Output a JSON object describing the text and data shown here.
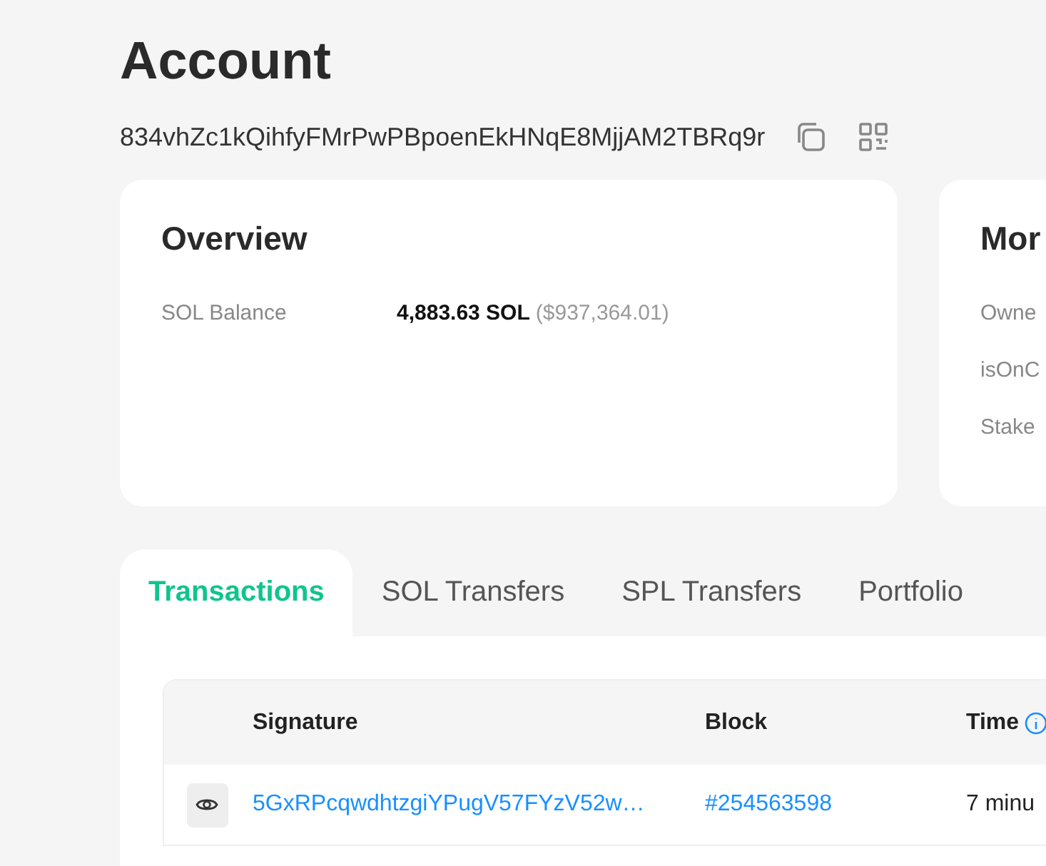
{
  "title": "Account",
  "address": "834vhZc1kQihfyFMrPwPBpoenEkHNqE8MjjAM2TBRq9r",
  "overview": {
    "title": "Overview",
    "rows": [
      {
        "label": "SOL Balance",
        "value": "4,883.63 SOL",
        "secondary": "($937,364.01)"
      }
    ]
  },
  "more_card": {
    "title": "Mor",
    "labels": [
      "Owne",
      "isOnC",
      "Stake"
    ]
  },
  "tabs": [
    {
      "label": "Transactions",
      "selected": true
    },
    {
      "label": "SOL Transfers",
      "selected": false
    },
    {
      "label": "SPL Transfers",
      "selected": false
    },
    {
      "label": "Portfolio",
      "selected": false
    }
  ],
  "table": {
    "columns": [
      "Signature",
      "Block",
      "Time"
    ],
    "rows": [
      {
        "signature": "5GxRPcqwdhtzgiYPugV57FYzV52w…",
        "block": "#254563598",
        "time": "7 minu"
      }
    ]
  }
}
